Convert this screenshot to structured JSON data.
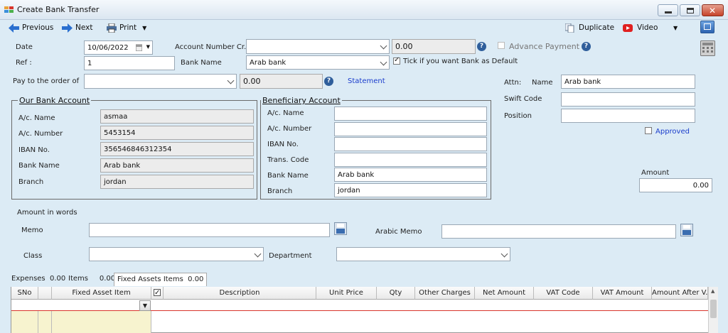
{
  "window": {
    "title": "Create Bank Transfer"
  },
  "toolbar": {
    "previous": "Previous",
    "next": "Next",
    "print": "Print",
    "duplicate": "Duplicate",
    "video": "Video"
  },
  "header": {
    "date_label": "Date",
    "date_value": "10/06/2022",
    "ref_label": "Ref :",
    "ref_value": "1",
    "account_number_cr_label": "Account Number Cr.",
    "account_number_cr_value": "",
    "account_amount": "0.00",
    "advance_payment_label": "Advance Payment",
    "bank_name_label": "Bank Name",
    "bank_name_value": "Arab bank",
    "default_bank_label": "Tick if you want Bank as Default",
    "pay_to_label": "Pay to the order of",
    "pay_to_value": "",
    "pay_to_amount": "0.00",
    "statement_link": "Statement"
  },
  "our_bank": {
    "title": "Our Bank Account",
    "ac_name_label": "A/c. Name",
    "ac_name_value": "asmaa",
    "ac_number_label": "A/c. Number",
    "ac_number_value": "5453154",
    "iban_label": "IBAN No.",
    "iban_value": "356546846312354",
    "bank_name_label": "Bank Name",
    "bank_name_value": "Arab bank",
    "branch_label": "Branch",
    "branch_value": "jordan"
  },
  "beneficiary": {
    "title": "Beneficiary Account",
    "ac_name_label": "A/c. Name",
    "ac_number_label": "A/c. Number",
    "iban_label": "IBAN No.",
    "trans_code_label": "Trans. Code",
    "bank_name_label": "Bank Name",
    "bank_name_value": "Arab bank",
    "branch_label": "Branch",
    "branch_value": "jordan"
  },
  "right_panel": {
    "attn_label": "Attn:",
    "name_label": "Name",
    "name_value": "Arab bank",
    "swift_label": "Swift Code",
    "position_label": "Position",
    "approved_label": "Approved",
    "amount_label": "Amount",
    "amount_value": "0.00"
  },
  "lower": {
    "amount_in_words_label": "Amount in words",
    "memo_label": "Memo",
    "arabic_memo_label": "Arabic Memo",
    "class_label": "Class",
    "department_label": "Department"
  },
  "tabs": [
    {
      "label": "Expenses",
      "value": "0.00"
    },
    {
      "label": "Items",
      "value": "0.00"
    },
    {
      "label": "Fixed Assets Items",
      "value": "0.00"
    }
  ],
  "grid": {
    "columns": [
      "SNo",
      "",
      "Fixed Asset Item",
      "",
      "Description",
      "Unit Price",
      "Qty",
      "Other Charges",
      "Net Amount",
      "VAT Code",
      "VAT Amount",
      "Amount After V..."
    ]
  },
  "colors": {
    "accent_link": "#1a3ccc",
    "background": "#dcebf5",
    "close_button": "#c7432a",
    "grid_red_line": "#d9342b"
  }
}
